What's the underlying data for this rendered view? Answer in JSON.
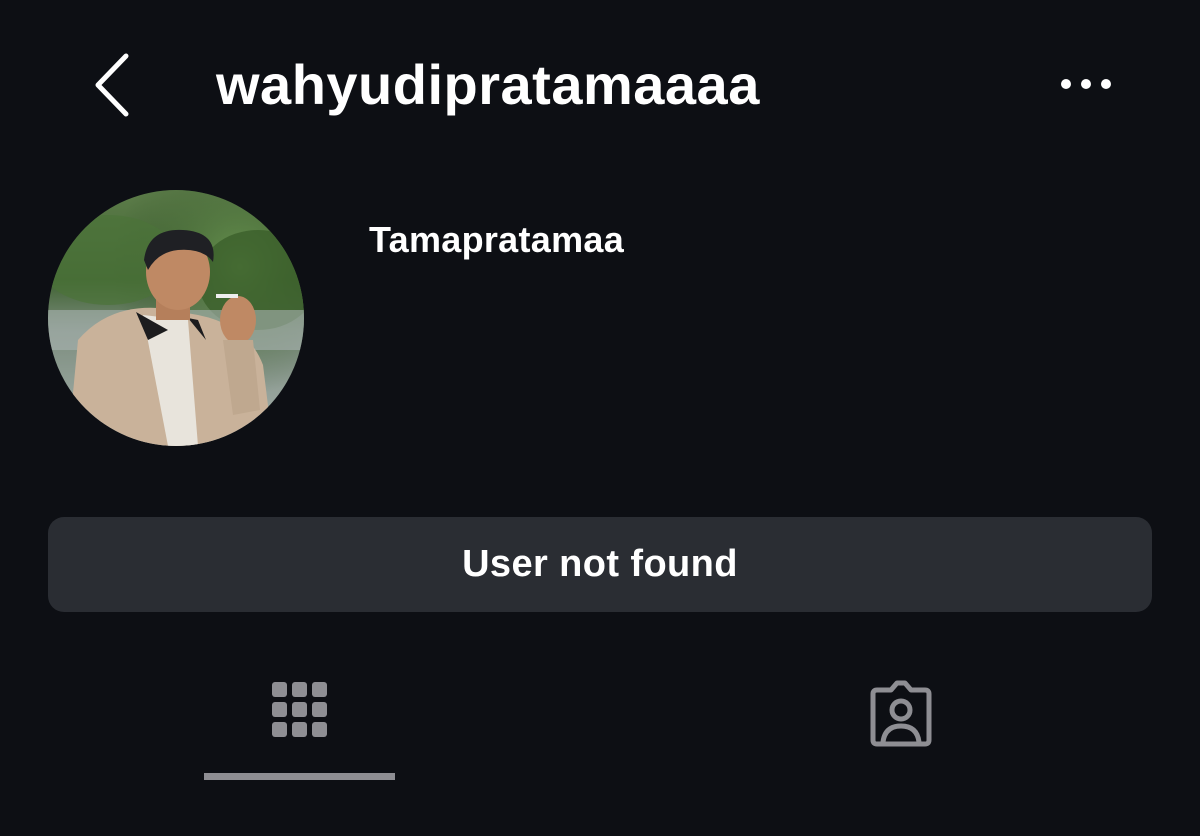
{
  "header": {
    "username": "wahyudipratamaaaa",
    "back_icon": "chevron-left-icon",
    "more_icon": "more-horizontal-icon"
  },
  "profile": {
    "display_name": "Tamapratamaa",
    "avatar_description_icon": "profile-photo"
  },
  "status": {
    "label": "User not found"
  },
  "tabs": [
    {
      "icon": "grid-icon",
      "active": true
    },
    {
      "icon": "tagged-person-icon",
      "active": false
    }
  ],
  "colors": {
    "background": "#0d0f14",
    "button_bg": "#2a2d33",
    "text": "#ffffff",
    "icon_muted": "#8e8e93"
  }
}
